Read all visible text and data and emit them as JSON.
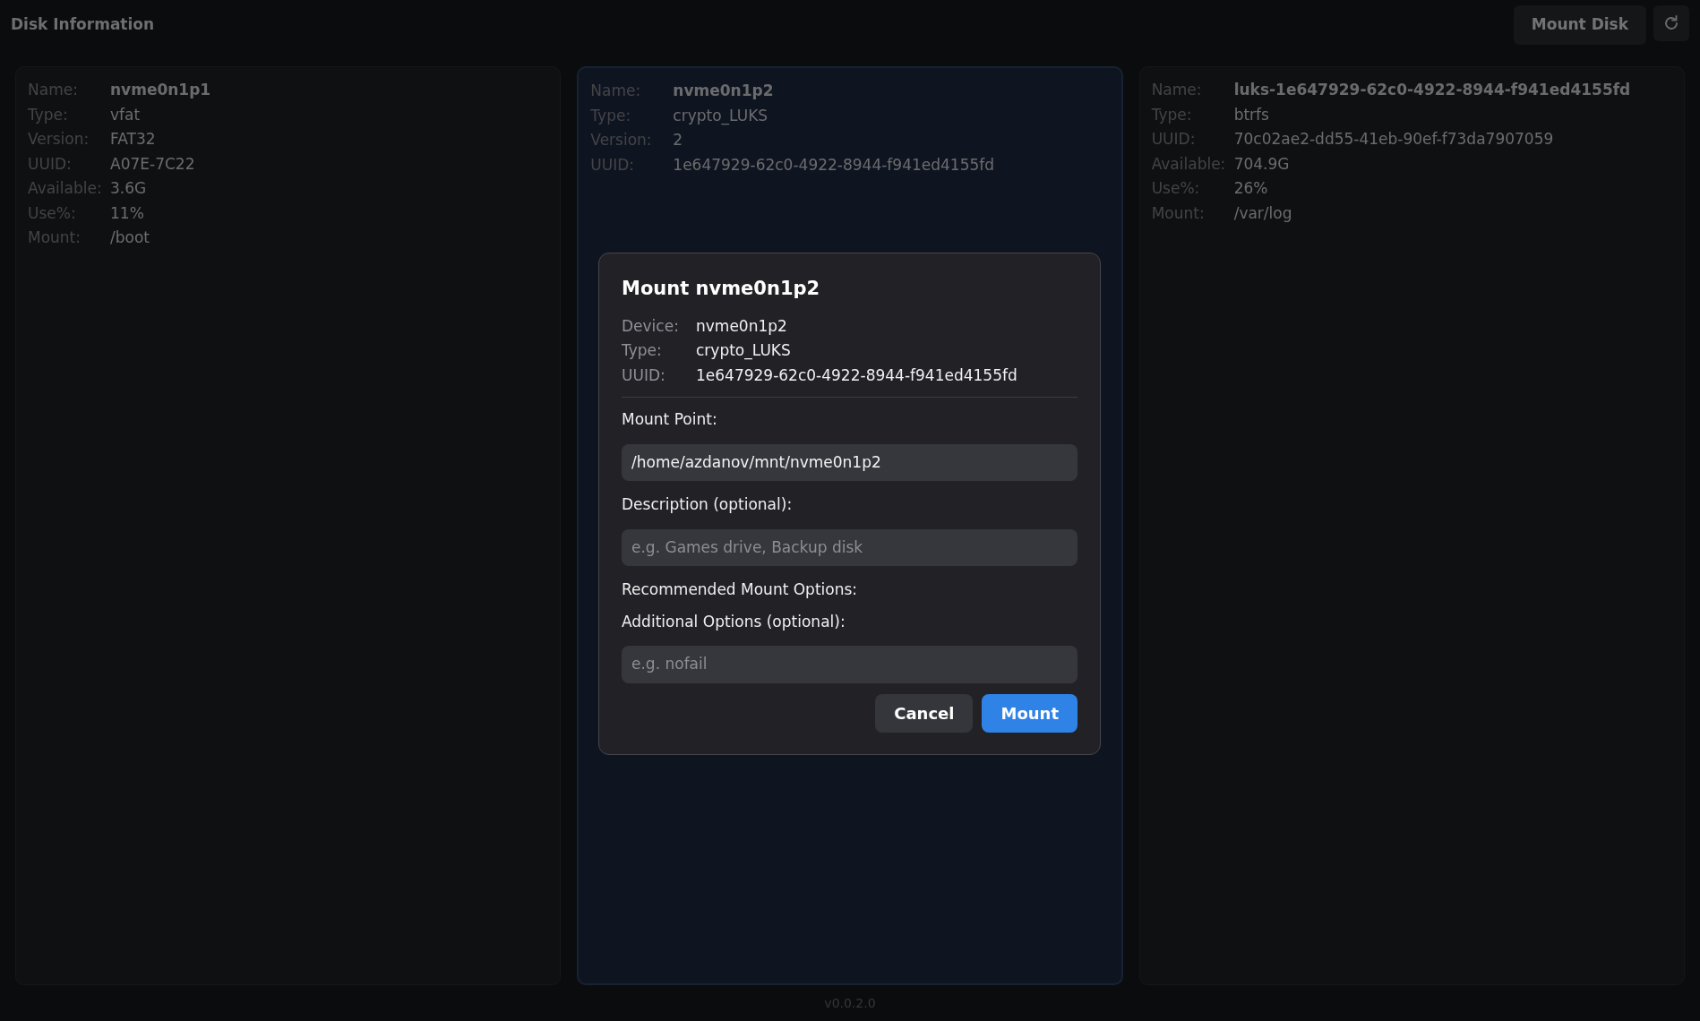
{
  "header": {
    "title": "Disk Information",
    "mount_button": "Mount Disk"
  },
  "disks": [
    {
      "selected": false,
      "fields": [
        {
          "label": "Name:",
          "value": "nvme0n1p1",
          "kind": "name"
        },
        {
          "label": "Type:",
          "value": "vfat",
          "kind": "plain"
        },
        {
          "label": "Version:",
          "value": "FAT32",
          "kind": "plain"
        },
        {
          "label": "UUID:",
          "value": "A07E-7C22",
          "kind": "plain"
        },
        {
          "label": "Available:",
          "value": "3.6G",
          "kind": "plain"
        },
        {
          "label": "Use%:",
          "value": "11%",
          "kind": "plain"
        },
        {
          "label": "Mount:",
          "value": "/boot",
          "kind": "plain"
        }
      ]
    },
    {
      "selected": true,
      "fields": [
        {
          "label": "Name:",
          "value": "nvme0n1p2",
          "kind": "name"
        },
        {
          "label": "Type:",
          "value": "crypto_LUKS",
          "kind": "plain"
        },
        {
          "label": "Version:",
          "value": "2",
          "kind": "plain"
        },
        {
          "label": "UUID:",
          "value": "1e647929-62c0-4922-8944-f941ed4155fd",
          "kind": "plain"
        }
      ]
    },
    {
      "selected": false,
      "fields": [
        {
          "label": "Name:",
          "value": "luks-1e647929-62c0-4922-8944-f941ed4155fd",
          "kind": "name"
        },
        {
          "label": "Type:",
          "value": "btrfs",
          "kind": "plain"
        },
        {
          "label": "UUID:",
          "value": "70c02ae2-dd55-41eb-90ef-f73da7907059",
          "kind": "plain"
        },
        {
          "label": "Available:",
          "value": "704.9G",
          "kind": "plain"
        },
        {
          "label": "Use%:",
          "value": "26%",
          "kind": "plain"
        },
        {
          "label": "Mount:",
          "value": "/var/log",
          "kind": "plain"
        }
      ]
    }
  ],
  "dialog": {
    "title": "Mount nvme0n1p2",
    "info": [
      {
        "label": "Device:",
        "value": "nvme0n1p2"
      },
      {
        "label": "Type:",
        "value": "crypto_LUKS"
      },
      {
        "label": "UUID:",
        "value": "1e647929-62c0-4922-8944-f941ed4155fd"
      }
    ],
    "mount_point": {
      "label": "Mount Point:",
      "value": "/home/azdanov/mnt/nvme0n1p2"
    },
    "description": {
      "label": "Description (optional):",
      "placeholder": "e.g. Games drive, Backup disk"
    },
    "recommended_label": "Recommended Mount Options:",
    "additional": {
      "label": "Additional Options (optional):",
      "placeholder": "e.g. nofail"
    },
    "buttons": [
      {
        "label": "Cancel",
        "kind": "secondary"
      },
      {
        "label": "Mount",
        "kind": "primary"
      }
    ]
  },
  "footer": {
    "version": "v0.0.2.0"
  }
}
